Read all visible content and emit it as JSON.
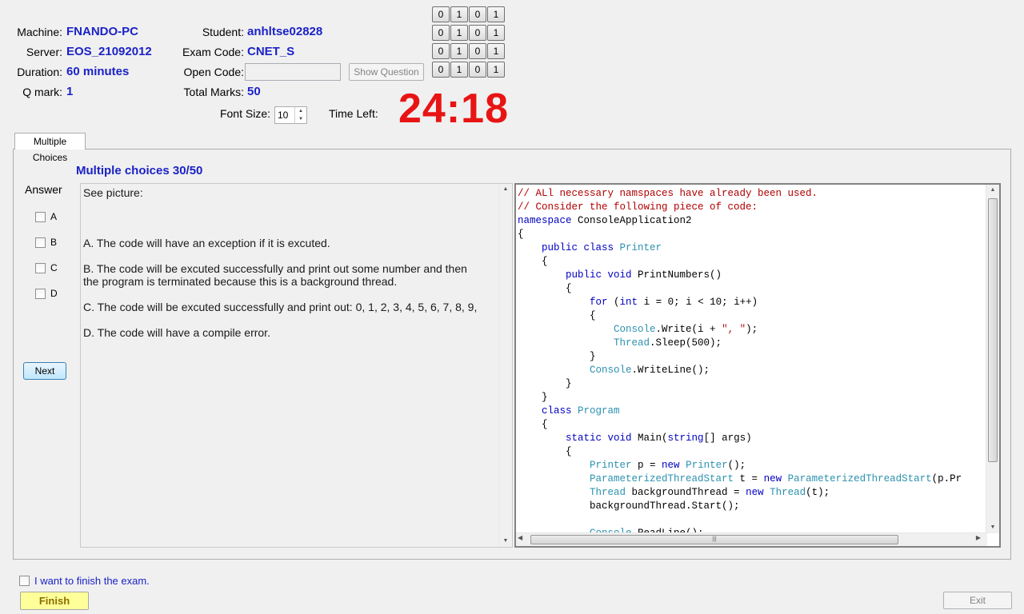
{
  "info": {
    "machine_label": "Machine:",
    "machine_value": "FNANDO-PC",
    "server_label": "Server:",
    "server_value": "EOS_21092012",
    "duration_label": "Duration:",
    "duration_value": "60 minutes",
    "qmark_label": "Q mark:",
    "qmark_value": "1",
    "student_label": "Student:",
    "student_value": "anhltse02828",
    "exam_code_label": "Exam Code:",
    "exam_code_value": "CNET_S",
    "open_code_label": "Open Code:",
    "open_code_value": "",
    "show_question_label": "Show Question",
    "total_marks_label": "Total Marks:",
    "total_marks_value": "50",
    "font_size_label": "Font Size:",
    "font_size_value": "10",
    "time_left_label": "Time Left:",
    "time_left_value": "24:18"
  },
  "bit_rows": [
    [
      "0",
      "1",
      "0",
      "1"
    ],
    [
      "0",
      "1",
      "0",
      "1"
    ],
    [
      "0",
      "1",
      "0",
      "1"
    ],
    [
      "0",
      "1",
      "0",
      "1"
    ]
  ],
  "tab": {
    "label": "Multiple Choices"
  },
  "question": {
    "title": "Multiple choices 30/50",
    "prompt": "See picture:",
    "answer_label": "Answer",
    "options": [
      {
        "letter": "A",
        "text": "A.  The code will have an exception if it is excuted."
      },
      {
        "letter": "B",
        "text": "B.  The code will be excuted successfully and print out some number and then the program is terminated because this is a background thread."
      },
      {
        "letter": "C",
        "text": "C.  The code will be excuted successfully and print out: 0, 1, 2, 3, 4, 5, 6, 7, 8, 9,"
      },
      {
        "letter": "D",
        "text": "D.  The code will have a compile error."
      }
    ],
    "next_label": "Next"
  },
  "code_lines": [
    [
      [
        "c-comment",
        "// ALl necessary namspaces have already been used."
      ]
    ],
    [
      [
        "c-comment",
        "// Consider the following piece of code:"
      ]
    ],
    [
      [
        "c-kw",
        "namespace"
      ],
      [
        "",
        " ConsoleApplication2"
      ]
    ],
    [
      [
        "",
        "{"
      ]
    ],
    [
      [
        "",
        "    "
      ],
      [
        "c-kw",
        "public class"
      ],
      [
        "",
        " "
      ],
      [
        "c-type",
        "Printer"
      ]
    ],
    [
      [
        "",
        "    {"
      ]
    ],
    [
      [
        "",
        "        "
      ],
      [
        "c-kw",
        "public void"
      ],
      [
        "",
        " PrintNumbers()"
      ]
    ],
    [
      [
        "",
        "        {"
      ]
    ],
    [
      [
        "",
        "            "
      ],
      [
        "c-kw",
        "for"
      ],
      [
        "",
        " ("
      ],
      [
        "c-kw",
        "int"
      ],
      [
        "",
        " i = 0; i < 10; i++)"
      ]
    ],
    [
      [
        "",
        "            {"
      ]
    ],
    [
      [
        "",
        "                "
      ],
      [
        "c-type",
        "Console"
      ],
      [
        "",
        ".Write(i + "
      ],
      [
        "c-str",
        "\", \""
      ],
      [
        "",
        ");"
      ]
    ],
    [
      [
        "",
        "                "
      ],
      [
        "c-type",
        "Thread"
      ],
      [
        "",
        ".Sleep(500);"
      ]
    ],
    [
      [
        "",
        "            }"
      ]
    ],
    [
      [
        "",
        "            "
      ],
      [
        "c-type",
        "Console"
      ],
      [
        "",
        ".WriteLine();"
      ]
    ],
    [
      [
        "",
        "        }"
      ]
    ],
    [
      [
        "",
        "    }"
      ]
    ],
    [
      [
        "",
        "    "
      ],
      [
        "c-kw",
        "class"
      ],
      [
        "",
        " "
      ],
      [
        "c-type",
        "Program"
      ]
    ],
    [
      [
        "",
        "    {"
      ]
    ],
    [
      [
        "",
        "        "
      ],
      [
        "c-kw",
        "static void"
      ],
      [
        "",
        " Main("
      ],
      [
        "c-kw",
        "string"
      ],
      [
        "",
        "[] args)"
      ]
    ],
    [
      [
        "",
        "        {"
      ]
    ],
    [
      [
        "",
        "            "
      ],
      [
        "c-type",
        "Printer"
      ],
      [
        "",
        " p = "
      ],
      [
        "c-kw",
        "new"
      ],
      [
        "",
        " "
      ],
      [
        "c-type",
        "Printer"
      ],
      [
        "",
        "();"
      ]
    ],
    [
      [
        "",
        "            "
      ],
      [
        "c-type",
        "ParameterizedThreadStart"
      ],
      [
        "",
        " t = "
      ],
      [
        "c-kw",
        "new"
      ],
      [
        "",
        " "
      ],
      [
        "c-type",
        "ParameterizedThreadStart"
      ],
      [
        "",
        "(p.Pr"
      ]
    ],
    [
      [
        "",
        "            "
      ],
      [
        "c-type",
        "Thread"
      ],
      [
        "",
        " backgroundThread = "
      ],
      [
        "c-kw",
        "new"
      ],
      [
        "",
        " "
      ],
      [
        "c-type",
        "Thread"
      ],
      [
        "",
        "(t);"
      ]
    ],
    [
      [
        "",
        "            backgroundThread.Start();"
      ]
    ],
    [
      [
        "",
        ""
      ]
    ],
    [
      [
        "",
        "            "
      ],
      [
        "c-type",
        "Console"
      ],
      [
        "",
        ".ReadLine();"
      ]
    ]
  ],
  "footer": {
    "finish_checkbox_label": "I want to finish the exam.",
    "finish_label": "Finish",
    "exit_label": "Exit"
  },
  "colors": {
    "value_blue": "#1b22c6",
    "timer_red": "#e81414",
    "finish_yellow": "#ffff99"
  }
}
